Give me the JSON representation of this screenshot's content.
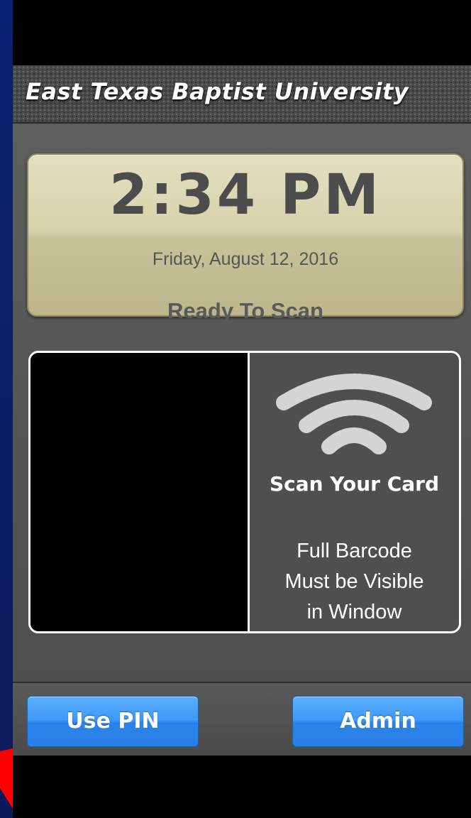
{
  "header": {
    "title": "East Texas Baptist University"
  },
  "clock": {
    "time": "2:34 PM",
    "date": "Friday, August 12, 2016",
    "status": "Ready To Scan"
  },
  "scanner": {
    "icon": "wireless-signal-icon",
    "title": "Scan Your Card",
    "instructions": [
      "Full Barcode",
      "Must be Visible",
      "in Window"
    ]
  },
  "footer": {
    "pin_button": "Use PIN",
    "admin_button": "Admin"
  },
  "colors": {
    "slide_background": "#0a1f66",
    "clock_panel": "#d6d2ac",
    "button_blue": "#3d97f5",
    "arrow": "#ff0000"
  }
}
